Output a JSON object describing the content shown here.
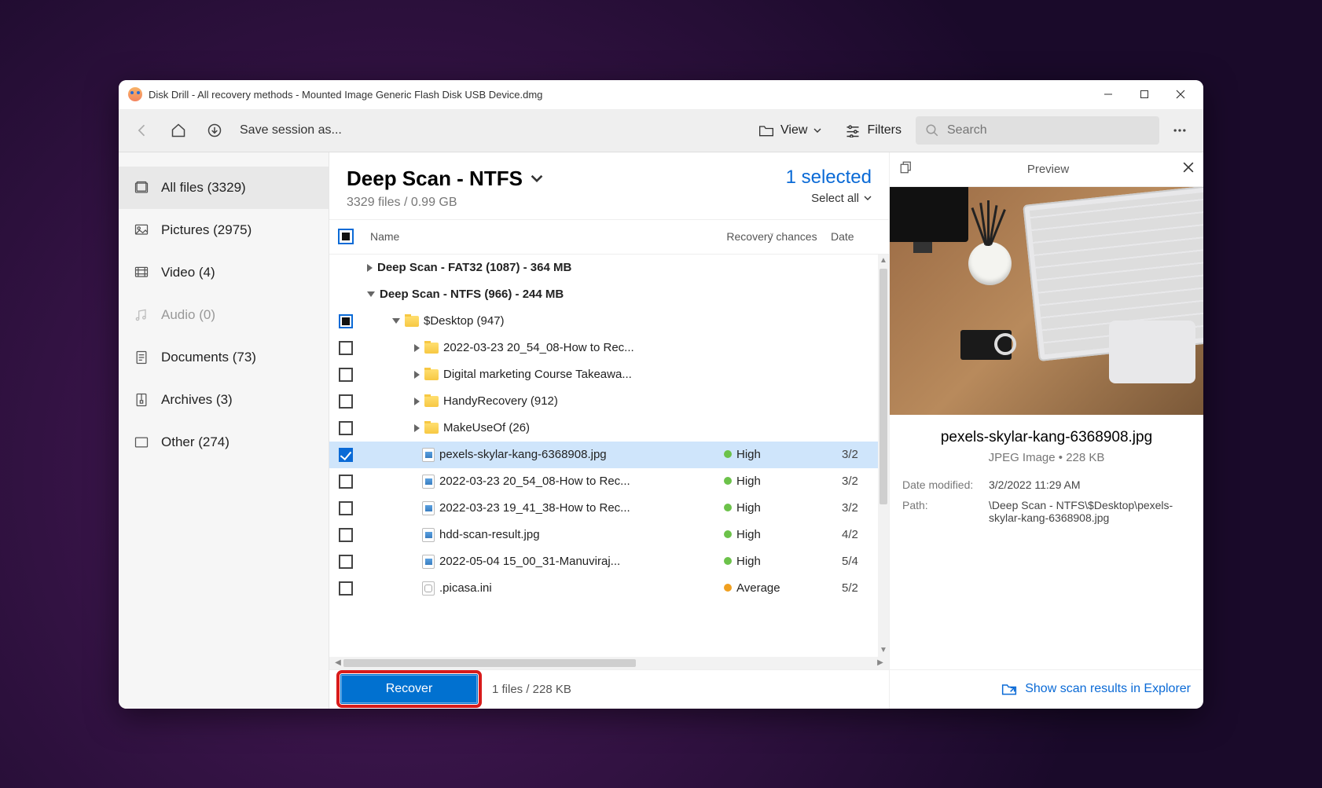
{
  "window": {
    "title": "Disk Drill - All recovery methods - Mounted Image Generic Flash Disk USB Device.dmg"
  },
  "toolbar": {
    "save_session": "Save session as...",
    "view_label": "View",
    "filters_label": "Filters",
    "search_placeholder": "Search"
  },
  "sidebar": {
    "items": [
      {
        "label": "All files (3329)",
        "icon": "stack-icon",
        "active": true
      },
      {
        "label": "Pictures (2975)",
        "icon": "picture-icon"
      },
      {
        "label": "Video (4)",
        "icon": "video-icon"
      },
      {
        "label": "Audio (0)",
        "icon": "audio-icon",
        "muted": true
      },
      {
        "label": "Documents (73)",
        "icon": "document-icon"
      },
      {
        "label": "Archives (3)",
        "icon": "archive-icon"
      },
      {
        "label": "Other (274)",
        "icon": "other-icon"
      }
    ]
  },
  "center": {
    "title": "Deep Scan - NTFS",
    "subtitle": "3329 files / 0.99 GB",
    "selected_label": "1 selected",
    "select_all": "Select all",
    "columns": {
      "name": "Name",
      "recovery": "Recovery chances",
      "date": "Date"
    },
    "rows": [
      {
        "type": "section",
        "name": "Deep Scan - FAT32 (1087) - 364 MB",
        "expanded": false
      },
      {
        "type": "section",
        "name": "Deep Scan - NTFS (966) - 244 MB",
        "expanded": true
      },
      {
        "type": "folder",
        "indent": 1,
        "name": "$Desktop (947)",
        "expanded": true,
        "cb": "partial"
      },
      {
        "type": "folder",
        "indent": 2,
        "name": "2022-03-23 20_54_08-How to Rec..."
      },
      {
        "type": "folder",
        "indent": 2,
        "name": "Digital marketing Course Takeawa..."
      },
      {
        "type": "folder",
        "indent": 2,
        "name": "HandyRecovery (912)"
      },
      {
        "type": "folder",
        "indent": 2,
        "name": "MakeUseOf (26)"
      },
      {
        "type": "file",
        "indent": 3,
        "icon": "img",
        "name": "pexels-skylar-kang-6368908.jpg",
        "recovery": "High",
        "dot": "green",
        "date": "3/2",
        "cb": "checked",
        "selected": true
      },
      {
        "type": "file",
        "indent": 3,
        "icon": "img",
        "name": "2022-03-23 20_54_08-How to Rec...",
        "recovery": "High",
        "dot": "green",
        "date": "3/2"
      },
      {
        "type": "file",
        "indent": 3,
        "icon": "img",
        "name": "2022-03-23 19_41_38-How to Rec...",
        "recovery": "High",
        "dot": "green",
        "date": "3/2"
      },
      {
        "type": "file",
        "indent": 3,
        "icon": "img",
        "name": "hdd-scan-result.jpg",
        "recovery": "High",
        "dot": "green",
        "date": "4/2"
      },
      {
        "type": "file",
        "indent": 3,
        "icon": "img",
        "name": "2022-05-04 15_00_31-Manuviraj...",
        "recovery": "High",
        "dot": "green",
        "date": "5/4"
      },
      {
        "type": "file",
        "indent": 3,
        "icon": "ini",
        "name": ".picasa.ini",
        "recovery": "Average",
        "dot": "orange",
        "date": "5/2"
      }
    ],
    "footer": {
      "recover": "Recover",
      "stats": "1 files / 228 KB"
    }
  },
  "preview": {
    "title": "Preview",
    "filename": "pexels-skylar-kang-6368908.jpg",
    "meta": "JPEG Image • 228 KB",
    "date_modified_label": "Date modified:",
    "date_modified": "3/2/2022 11:29 AM",
    "path_label": "Path:",
    "path": "\\Deep Scan - NTFS\\$Desktop\\pexels-skylar-kang-6368908.jpg",
    "explorer_link": "Show scan results in Explorer"
  }
}
